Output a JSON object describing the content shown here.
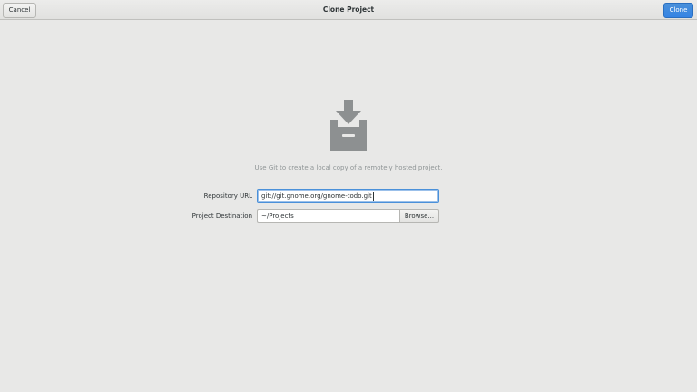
{
  "headerbar": {
    "title": "Clone Project",
    "cancel_label": "Cancel",
    "clone_label": "Clone"
  },
  "main": {
    "icon": "download-to-tray-icon",
    "hint": "Use Git to create a local copy of a remotely hosted project.",
    "repository_url_label": "Repository URL",
    "repository_url_value": "git://git.gnome.org/gnome-todo.git",
    "project_destination_label": "Project Destination",
    "project_destination_value": "~/Projects",
    "browse_label": "Browse..."
  },
  "colors": {
    "accent": "#3584e4",
    "background": "#e8e8e7",
    "icon": "#8d9091",
    "hint_text": "#8f9596"
  }
}
